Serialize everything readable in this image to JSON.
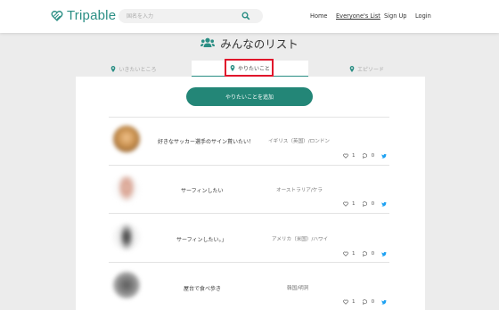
{
  "navbar": {
    "logo_text": "Tripable",
    "search_placeholder": "国名を入力",
    "links": [
      "Home",
      "Everyone's List",
      "Sign Up",
      "Login"
    ],
    "active_link": "Everyone's List"
  },
  "page": {
    "title": "みんなのリスト",
    "tabs": [
      "いきたいところ",
      "やりたいこと",
      "エピソード"
    ],
    "active_tab": "やりたいこと",
    "add_button": "やりたいことを追加"
  },
  "items": [
    {
      "title": "好きなサッカー選手のサイン貰いたい！",
      "place": "イギリス（英国）/ロンドン",
      "likes": "1",
      "comments": "0"
    },
    {
      "title": "サーフィンしたい",
      "place": "オーストラリア/ケラ",
      "likes": "1",
      "comments": "0"
    },
    {
      "title": "サーフィンしたい。」",
      "place": "アメリカ（米国）/ハワイ",
      "likes": "1",
      "comments": "0"
    },
    {
      "title": "屋台で食べ歩き",
      "place": "韓国/明洞",
      "likes": "1",
      "comments": "0"
    }
  ],
  "colors": {
    "brand": "#2a8e84",
    "button": "#238677",
    "highlight": "#e0142b",
    "twitter": "#1da1f2"
  }
}
